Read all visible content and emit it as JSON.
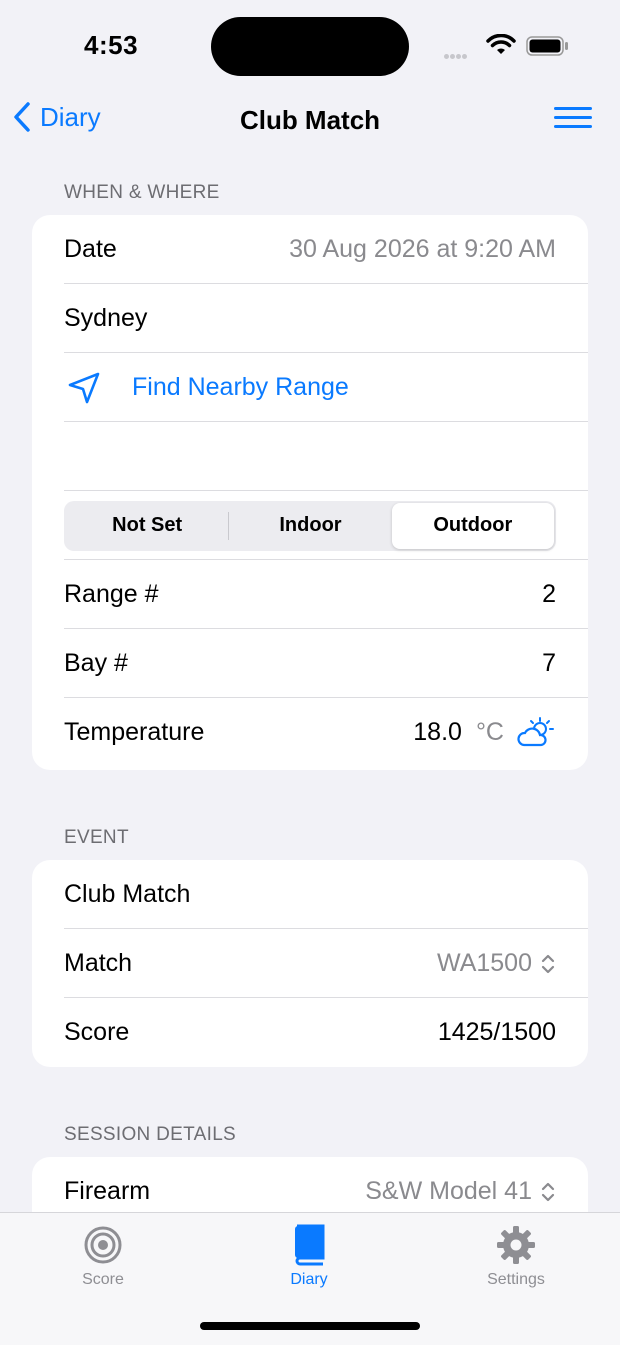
{
  "status": {
    "time": "4:53"
  },
  "nav": {
    "back_label": "Diary",
    "title": "Club Match"
  },
  "when_where": {
    "header": "WHEN & WHERE",
    "date_label": "Date",
    "date_value": "30 Aug 2026 at 9:20 AM",
    "location": "Sydney",
    "find_range": "Find Nearby Range",
    "segments": [
      "Not Set",
      "Indoor",
      "Outdoor"
    ],
    "selected_segment": "Outdoor",
    "range_label": "Range #",
    "range_value": "2",
    "bay_label": "Bay #",
    "bay_value": "7",
    "temp_label": "Temperature",
    "temp_value": "18.0",
    "temp_unit": "°C"
  },
  "event": {
    "header": "EVENT",
    "name": "Club Match",
    "match_label": "Match",
    "match_value": "WA1500",
    "score_label": "Score",
    "score_value": "1425/1500"
  },
  "session": {
    "header": "SESSION DETAILS",
    "firearm_label": "Firearm",
    "firearm_value": "S&W Model 41"
  },
  "tabs": [
    {
      "label": "Score",
      "icon": "target-icon",
      "active": false
    },
    {
      "label": "Diary",
      "icon": "book-icon",
      "active": true
    },
    {
      "label": "Settings",
      "icon": "gear-icon",
      "active": false
    }
  ],
  "colors": {
    "accent": "#0A7AFF",
    "background": "#F2F2F7"
  }
}
